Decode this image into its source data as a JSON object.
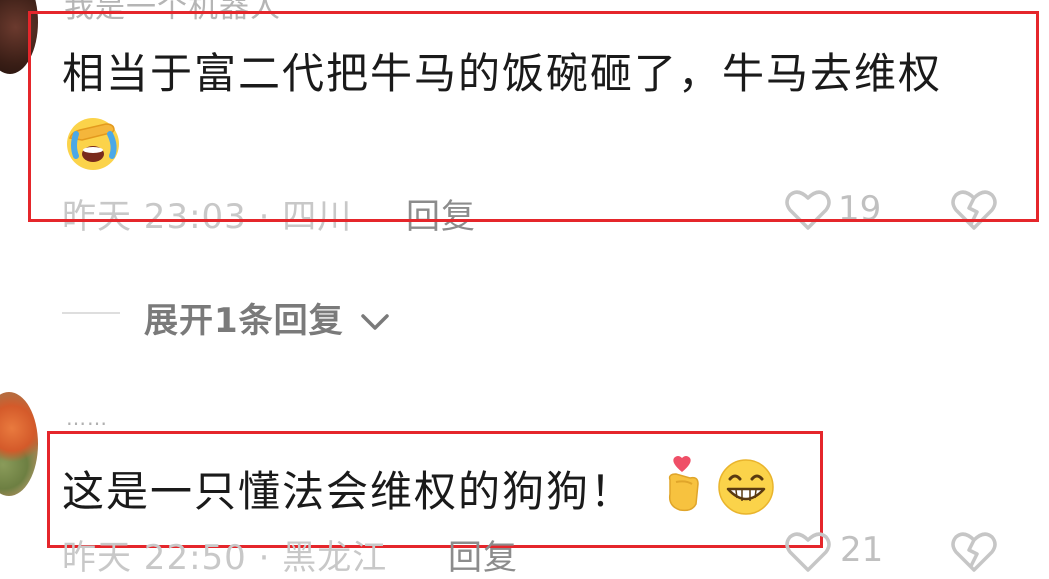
{
  "comment1": {
    "username": "我是一个机器人",
    "text": "相当于富二代把牛马的饭碗砸了，牛马去维权",
    "meta": "昨天 23:03 · 四川",
    "reply_label": "回复",
    "likes": "19"
  },
  "expand_replies": "展开1条回复",
  "comment2": {
    "username": "……",
    "text": "这是一只懂法会维权的狗狗！",
    "meta": "昨天 22:50 · 黑龙江",
    "reply_label": "回复",
    "likes": "21"
  },
  "colors": {
    "highlight": "#e5262b",
    "meta_text": "#c8c8c8",
    "expand_text": "#7a7a7a"
  },
  "icons": [
    "heart-outline-icon",
    "broken-heart-icon",
    "chevron-down-icon",
    "facepalm-crying-emoji",
    "finger-heart-emoji",
    "grinning-emoji"
  ]
}
